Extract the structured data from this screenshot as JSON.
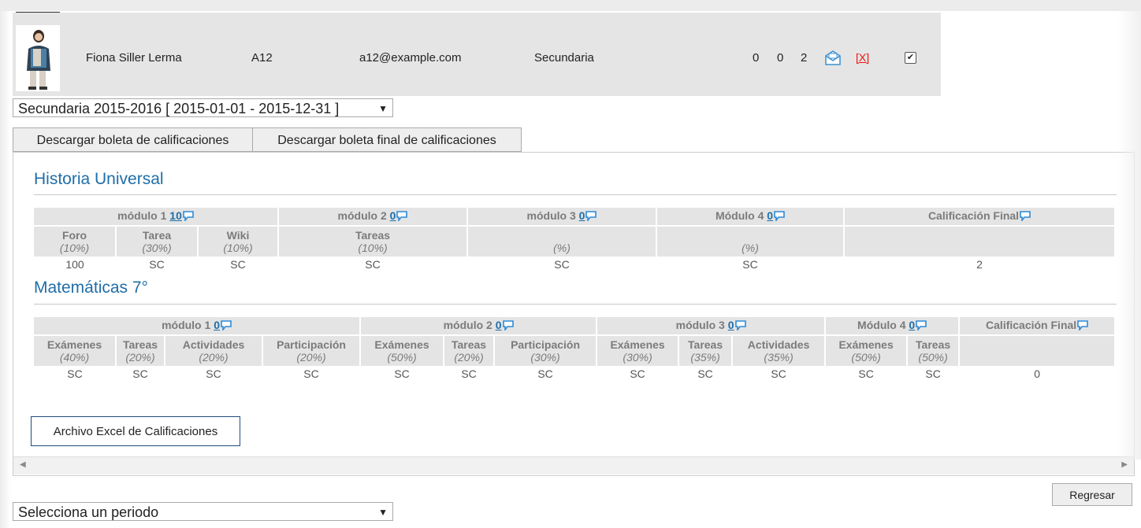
{
  "student": {
    "name": "Fiona Siller Lerma",
    "id": "A12",
    "email": "a12@example.com",
    "level": "Secundaria",
    "count_a": "0",
    "count_b": "0",
    "count_c": "2",
    "remove_label": "[X]"
  },
  "period_select": {
    "value": "Secundaria 2015-2016 [ 2015-01-01 - 2015-12-31 ]"
  },
  "tabs": [
    {
      "label": "Descargar boleta de calificaciones"
    },
    {
      "label": "Descargar boleta final de calificaciones"
    }
  ],
  "courses": [
    {
      "title": "Historia Universal",
      "modules": [
        {
          "label": "módulo 1",
          "count": "10"
        },
        {
          "label": "módulo 2",
          "count": "0"
        },
        {
          "label": "módulo 3",
          "count": "0"
        },
        {
          "label": "Módulo 4",
          "count": "0"
        },
        {
          "label": "Calificación Final",
          "count": ""
        }
      ],
      "columns": [
        {
          "name": "Foro",
          "weight": "(10%)",
          "value": "100"
        },
        {
          "name": "Tarea",
          "weight": "(30%)",
          "value": "SC"
        },
        {
          "name": "Wiki",
          "weight": "(10%)",
          "value": "SC"
        },
        {
          "name": "Tareas",
          "weight": "(10%)",
          "value": "SC"
        },
        {
          "name": "",
          "weight": "(%)",
          "value": "SC"
        },
        {
          "name": "",
          "weight": "(%)",
          "value": "SC"
        },
        {
          "name": "",
          "weight": "",
          "value": "2"
        }
      ]
    },
    {
      "title": "Matemáticas 7°",
      "modules": [
        {
          "label": "módulo 1",
          "count": "0"
        },
        {
          "label": "módulo 2",
          "count": "0"
        },
        {
          "label": "módulo 3",
          "count": "0"
        },
        {
          "label": "Módulo 4",
          "count": "0"
        },
        {
          "label": "Calificación Final",
          "count": ""
        }
      ],
      "columns": [
        {
          "name": "Exámenes",
          "weight": "(40%)",
          "value": "SC"
        },
        {
          "name": "Tareas",
          "weight": "(20%)",
          "value": "SC"
        },
        {
          "name": "Actividades",
          "weight": "(20%)",
          "value": "SC"
        },
        {
          "name": "Participación",
          "weight": "(20%)",
          "value": "SC"
        },
        {
          "name": "Exámenes",
          "weight": "(50%)",
          "value": "SC"
        },
        {
          "name": "Tareas",
          "weight": "(20%)",
          "value": "SC"
        },
        {
          "name": "Participación",
          "weight": "(30%)",
          "value": "SC"
        },
        {
          "name": "Exámenes",
          "weight": "(30%)",
          "value": "SC"
        },
        {
          "name": "Tareas",
          "weight": "(35%)",
          "value": "SC"
        },
        {
          "name": "Actividades",
          "weight": "(35%)",
          "value": "SC"
        },
        {
          "name": "Exámenes",
          "weight": "(50%)",
          "value": "SC"
        },
        {
          "name": "Tareas",
          "weight": "(50%)",
          "value": "SC"
        },
        {
          "name": "",
          "weight": "",
          "value": "0"
        }
      ]
    }
  ],
  "excel_button": {
    "label": "Archivo Excel de Calificaciones"
  },
  "bottom_select": {
    "value": "Selecciona un periodo"
  },
  "back_button": {
    "label": "Regresar"
  },
  "colors": {
    "title_blue": "#1f6ea8",
    "header_gray": "#e4e4e4",
    "remove_red": "#e11111"
  }
}
